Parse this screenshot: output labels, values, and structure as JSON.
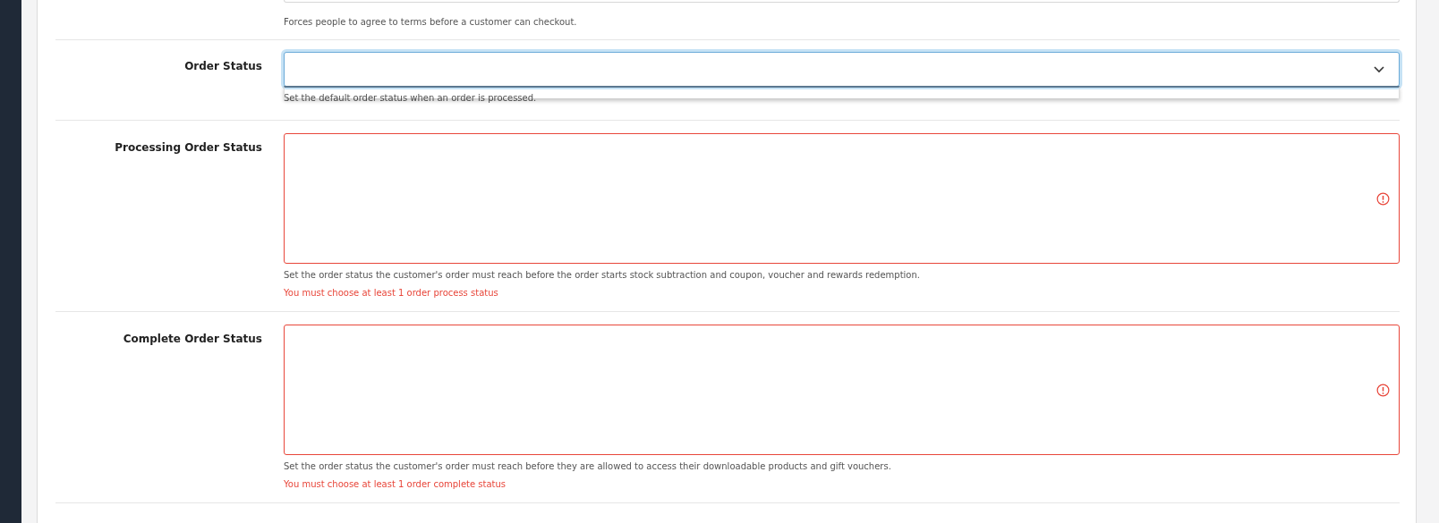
{
  "previous_field": {
    "help": "Forces people to agree to terms before a customer can checkout."
  },
  "settings": [
    {
      "kind": "select",
      "label": "Order Status",
      "focused": true,
      "dropdown_open": true,
      "help": "Set the default order status when an order is processed."
    },
    {
      "kind": "multiselect",
      "label": "Processing Order Status",
      "help": "Set the order status the customer's order must reach before the order starts stock subtraction and coupon, voucher and rewards redemption.",
      "error": "You must choose at least 1 order process status"
    },
    {
      "kind": "multiselect",
      "label": "Complete Order Status",
      "help": "Set the order status the customer's order must reach before they are allowed to access their downloadable products and gift vouchers.",
      "error": "You must choose at least 1 order complete status"
    }
  ]
}
